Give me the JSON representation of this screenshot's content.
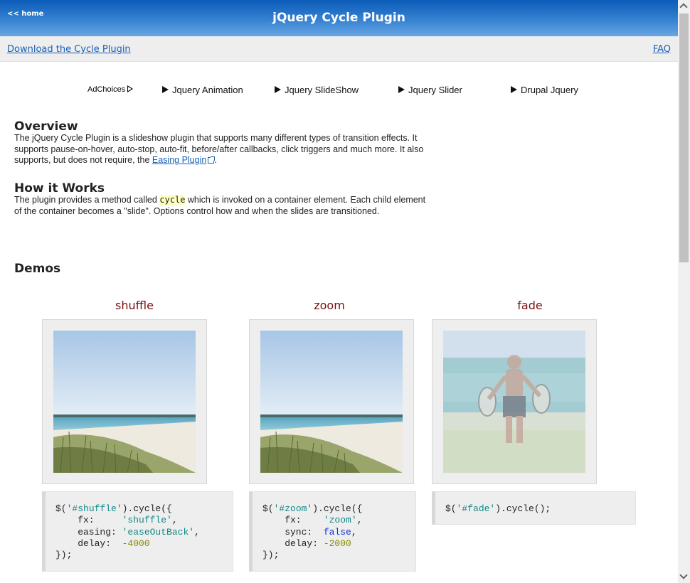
{
  "header": {
    "home_label": "<< home",
    "title": "jQuery Cycle Plugin"
  },
  "subbar": {
    "download_label": "Download the Cycle Plugin",
    "faq_label": "FAQ"
  },
  "ads": {
    "adchoices_label": "AdChoices",
    "links": [
      "Jquery Animation",
      "Jquery SlideShow",
      "Jquery Slider",
      "Drupal Jquery"
    ]
  },
  "overview": {
    "title": "Overview",
    "text_before_link": "The jQuery Cycle Plugin is a slideshow plugin that supports many different types of transition effects. It supports pause-on-hover, auto-stop, auto-fit, before/after callbacks, click triggers and much more. It also supports, but does not require, the ",
    "link_label": "Easing Plugin",
    "text_after_link": "."
  },
  "how": {
    "title": "How it Works",
    "text_before_code": "The plugin provides a method called ",
    "code": "cycle",
    "text_after_code": " which is invoked on a container element. Each child element of the container becomes a \"slide\". Options control how and when the slides are transitioned."
  },
  "demos": {
    "title": "Demos",
    "items": [
      {
        "name": "shuffle",
        "code": {
          "selector": "$(",
          "selector_str": "'#shuffle'",
          "call": ").cycle({",
          "lines": [
            {
              "key": "    fx:     ",
              "value": "'shuffle'",
              "type": "str",
              "suffix": ","
            },
            {
              "key": "    easing: ",
              "value": "'easeOutBack'",
              "type": "str",
              "suffix": ","
            },
            {
              "key": "    delay:  ",
              "value": "-4000",
              "type": "num",
              "suffix": ""
            }
          ],
          "close": "});"
        }
      },
      {
        "name": "zoom",
        "code": {
          "selector": "$(",
          "selector_str": "'#zoom'",
          "call": ").cycle({",
          "lines": [
            {
              "key": "    fx:    ",
              "value": "'zoom'",
              "type": "str",
              "suffix": ","
            },
            {
              "key": "    sync:  ",
              "value": "false",
              "type": "kw",
              "suffix": ","
            },
            {
              "key": "    delay: ",
              "value": "-2000",
              "type": "num",
              "suffix": ""
            }
          ],
          "close": "});"
        }
      },
      {
        "name": "fade",
        "code": {
          "selector": "$(",
          "selector_str": "'#fade'",
          "call": ").cycle();",
          "lines": [],
          "close": ""
        }
      }
    ]
  }
}
